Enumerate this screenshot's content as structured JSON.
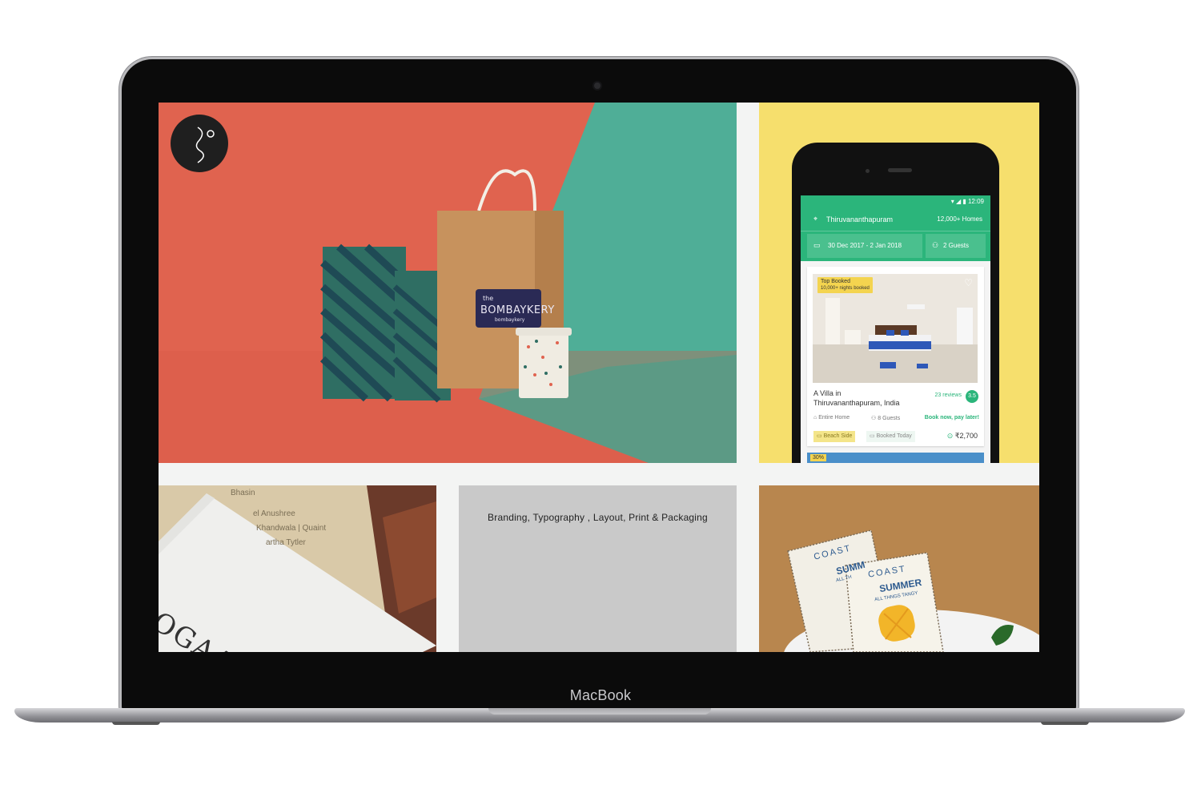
{
  "device": {
    "label": "MacBook"
  },
  "tiles": {
    "info": {
      "services": "Branding,  Typography ,  Layout,  Print & Packaging"
    },
    "bakery": {
      "brand_line1": "the",
      "brand_line2": "BOMBAYKERY",
      "brand_line3": "bombaykery"
    },
    "print": {
      "lines": [
        "Bhasin",
        "el Anushree",
        "Khandwala | Quaint",
        "artha Tytler"
      ],
      "big_text": "OGAAN"
    },
    "menu": {
      "card1_title": "COAST",
      "card1_sub": "SUMM",
      "card2_title": "COAST",
      "card2_sub": "SUMMER",
      "card2_tag": "ALL THNGS TANGY",
      "card1_tag": "ALL TH"
    }
  },
  "app": {
    "status_time": "12:09",
    "location": "Thiruvananthapuram",
    "homes_count": "12,000+ Homes",
    "date_range": "30 Dec 2017 - 2 Jan 2018",
    "guests": "2 Guests",
    "badge_title": "Top Booked",
    "badge_sub": "10,000+ nights booked",
    "listing_title_line1": "A Villa in",
    "listing_title_line2": "Thiruvananthapuram, India",
    "reviews": "23 reviews",
    "rating": "3.5",
    "home_type": "Entire Home",
    "capacity": "8 Guests",
    "cta": "Book now, pay later!",
    "tag1": "Beach Side",
    "tag2": "Booked Today",
    "price": "₹2,700",
    "next_badge": "30%"
  },
  "colors": {
    "coral": "#e0634f",
    "teal": "#4fae97",
    "app_green": "#2bb57b",
    "yellow": "#f6df6d"
  }
}
